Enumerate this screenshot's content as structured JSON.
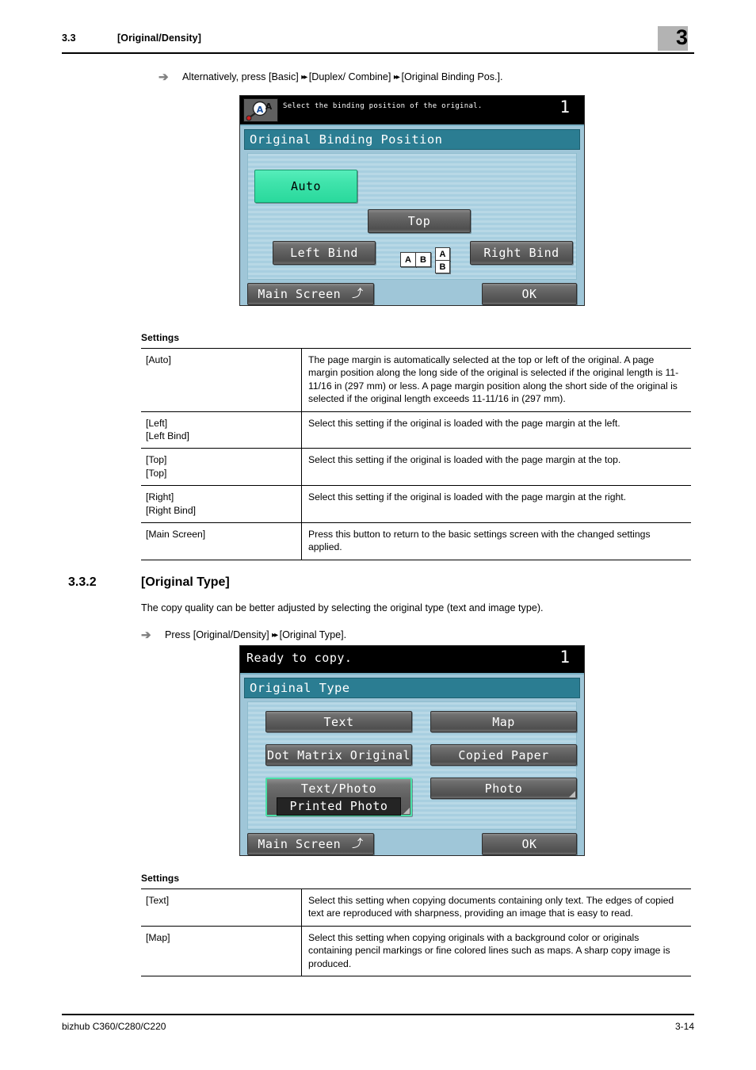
{
  "header": {
    "section_number": "3.3",
    "section_title": "[Original/Density]",
    "chapter_number": "3"
  },
  "step1": {
    "arrow": "➔",
    "text_before": "Alternatively, press [Basic]",
    "dbl1": "▸▸",
    "text_mid": "[Duplex/ Combine]",
    "dbl2": "▸▸",
    "text_after": "[Original Binding Pos.]."
  },
  "screen1": {
    "icon_name": "original-settings-icon",
    "status_message": "Select the binding position of the original.",
    "copy_count": "1",
    "title": "Original Binding Position",
    "buttons": {
      "auto": "Auto",
      "top": "Top",
      "left_bind": "Left Bind",
      "right_bind": "Right Bind",
      "main_screen": "Main Screen",
      "main_screen_arrow": "⤴",
      "ok": "OK"
    },
    "illustration": {
      "page_a": "A",
      "page_b": "B",
      "page_a2": "A",
      "page_b2": "B"
    }
  },
  "settings1": {
    "label": "Settings",
    "rows": [
      {
        "name": "[Auto]",
        "desc": "The page margin is automatically selected at the top or left of the original. A page margin position along the long side of the original is selected if the original length is 11-11/16 in (297 mm) or less. A page margin position along the short side of the original is selected if the original length exceeds 11-11/16 in (297 mm)."
      },
      {
        "name": "[Left]\n[Left Bind]",
        "desc": "Select this setting if the original is loaded with the page margin at the left."
      },
      {
        "name": "[Top]\n[Top]",
        "desc": "Select this setting if the original is loaded with the page margin at the top."
      },
      {
        "name": "[Right]\n[Right Bind]",
        "desc": "Select this setting if the original is loaded with the page margin at the right."
      },
      {
        "name": "[Main Screen]",
        "desc": "Press this button to return to the basic settings screen with the changed settings applied."
      }
    ]
  },
  "section332": {
    "number": "3.3.2",
    "title": "[Original Type]",
    "description": "The copy quality can be better adjusted by selecting the original type (text and image type).",
    "step": {
      "arrow": "➔",
      "text_before": "Press [Original/Density]",
      "dbl1": "▸▸",
      "text_after": "[Original Type]."
    }
  },
  "screen2": {
    "status_message": "Ready to copy.",
    "copy_count": "1",
    "title": "Original Type",
    "buttons": {
      "text": "Text",
      "map": "Map",
      "dot_matrix": "Dot Matrix Original",
      "copied_paper": "Copied Paper",
      "text_photo": "Text/Photo",
      "text_photo_sub": "Printed Photo",
      "photo": "Photo",
      "main_screen": "Main Screen",
      "main_screen_arrow": "⤴",
      "ok": "OK"
    }
  },
  "settings2": {
    "label": "Settings",
    "rows": [
      {
        "name": "[Text]",
        "desc": "Select this setting when copying documents containing only text. The edges of copied text are reproduced with sharpness, providing an image that is easy to read."
      },
      {
        "name": "[Map]",
        "desc": "Select this setting when copying originals with a background color or originals containing pencil markings or fine colored lines such as maps. A sharp copy image is produced."
      }
    ]
  },
  "footer": {
    "left": "bizhub C360/C280/C220",
    "right": "3-14"
  },
  "colors": {
    "lcd_title_bar": "#2b7d92",
    "lcd_background": "#b8d8e6",
    "lcd_button": "#5e5e5e",
    "accent_green": "#3fe3ab",
    "chapter_box": "#b3b3b3"
  }
}
